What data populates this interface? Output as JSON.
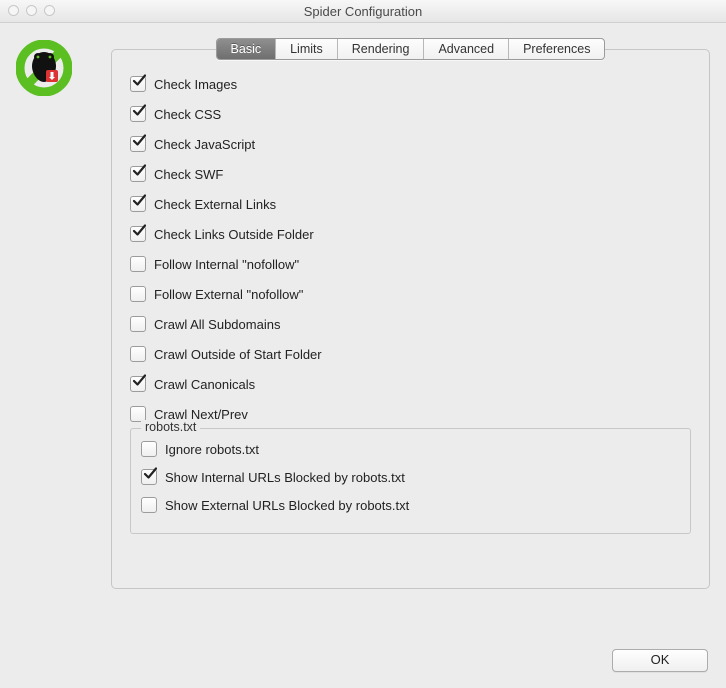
{
  "window": {
    "title": "Spider Configuration"
  },
  "tabs": {
    "basic": "Basic",
    "limits": "Limits",
    "rendering": "Rendering",
    "advanced": "Advanced",
    "preferences": "Preferences",
    "active": "basic"
  },
  "options": [
    {
      "key": "check-images",
      "label": "Check Images",
      "checked": true
    },
    {
      "key": "check-css",
      "label": "Check CSS",
      "checked": true
    },
    {
      "key": "check-javascript",
      "label": "Check JavaScript",
      "checked": true
    },
    {
      "key": "check-swf",
      "label": "Check SWF",
      "checked": true
    },
    {
      "key": "check-external-links",
      "label": "Check External Links",
      "checked": true
    },
    {
      "key": "check-links-outside",
      "label": "Check Links Outside Folder",
      "checked": true
    },
    {
      "key": "follow-internal-nf",
      "label": "Follow Internal \"nofollow\"",
      "checked": false
    },
    {
      "key": "follow-external-nf",
      "label": "Follow External \"nofollow\"",
      "checked": false
    },
    {
      "key": "crawl-all-subdomains",
      "label": "Crawl All Subdomains",
      "checked": false
    },
    {
      "key": "crawl-outside-start",
      "label": "Crawl Outside of Start Folder",
      "checked": false
    },
    {
      "key": "crawl-canonicals",
      "label": "Crawl Canonicals",
      "checked": true
    },
    {
      "key": "crawl-next-prev",
      "label": "Crawl Next/Prev",
      "checked": false
    }
  ],
  "robots": {
    "legend": "robots.txt",
    "items": [
      {
        "key": "ignore-robots",
        "label": "Ignore robots.txt",
        "checked": false
      },
      {
        "key": "show-internal-block",
        "label": "Show Internal URLs Blocked by robots.txt",
        "checked": true
      },
      {
        "key": "show-external-block",
        "label": "Show External URLs Blocked by robots.txt",
        "checked": false
      }
    ]
  },
  "buttons": {
    "ok": "OK"
  }
}
